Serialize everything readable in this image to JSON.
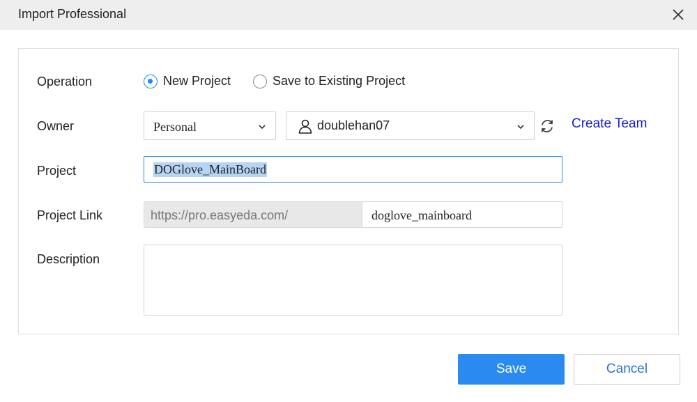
{
  "dialog": {
    "title": "Import Professional"
  },
  "form": {
    "operation_label": "Operation",
    "operation_options": [
      "New Project",
      "Save to Existing Project"
    ],
    "operation_selected": "New Project",
    "owner_label": "Owner",
    "owner_type": "Personal",
    "owner_user": "doublehan07",
    "create_team_label": "Create Team",
    "project_label": "Project",
    "project_value": "DOGlove_MainBoard",
    "project_link_label": "Project Link",
    "project_link_prefix": "https://pro.easyeda.com/",
    "project_link_value": "doglove_mainboard",
    "description_label": "Description",
    "description_value": ""
  },
  "buttons": {
    "save_label": "Save",
    "cancel_label": "Cancel"
  },
  "colors": {
    "accent": "#2a8af0",
    "link": "#1a1adc",
    "selection": "#b6d4f3"
  }
}
